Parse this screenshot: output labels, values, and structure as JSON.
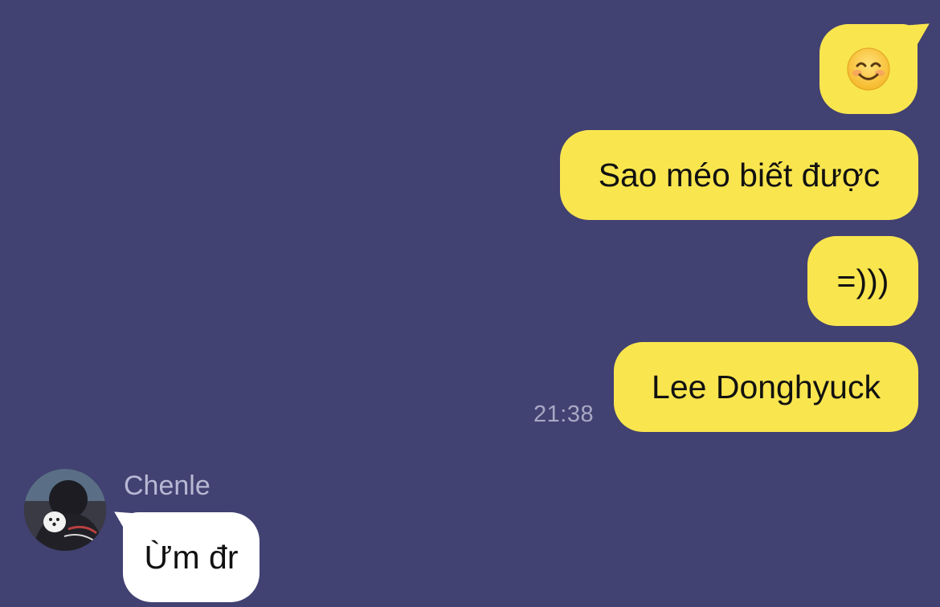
{
  "conversation": {
    "outgoing": [
      {
        "type": "emoji",
        "icon": "smiling-face-emoji"
      },
      {
        "type": "text",
        "text": "Sao méo biết được"
      },
      {
        "type": "text",
        "text": "=)))"
      },
      {
        "type": "text",
        "text": "Lee Donghyuck"
      }
    ],
    "outgoing_time": "21:38",
    "incoming": {
      "sender": "Chenle",
      "avatar_icon": "profile-photo",
      "messages": [
        {
          "type": "text",
          "text": "Ừm đr"
        }
      ]
    }
  },
  "colors": {
    "background": "#414172",
    "outgoing_bubble": "#F9E54E",
    "incoming_bubble": "#FFFFFF",
    "timestamp": "#A8A8C4",
    "sender_name": "#B8B8D4"
  }
}
